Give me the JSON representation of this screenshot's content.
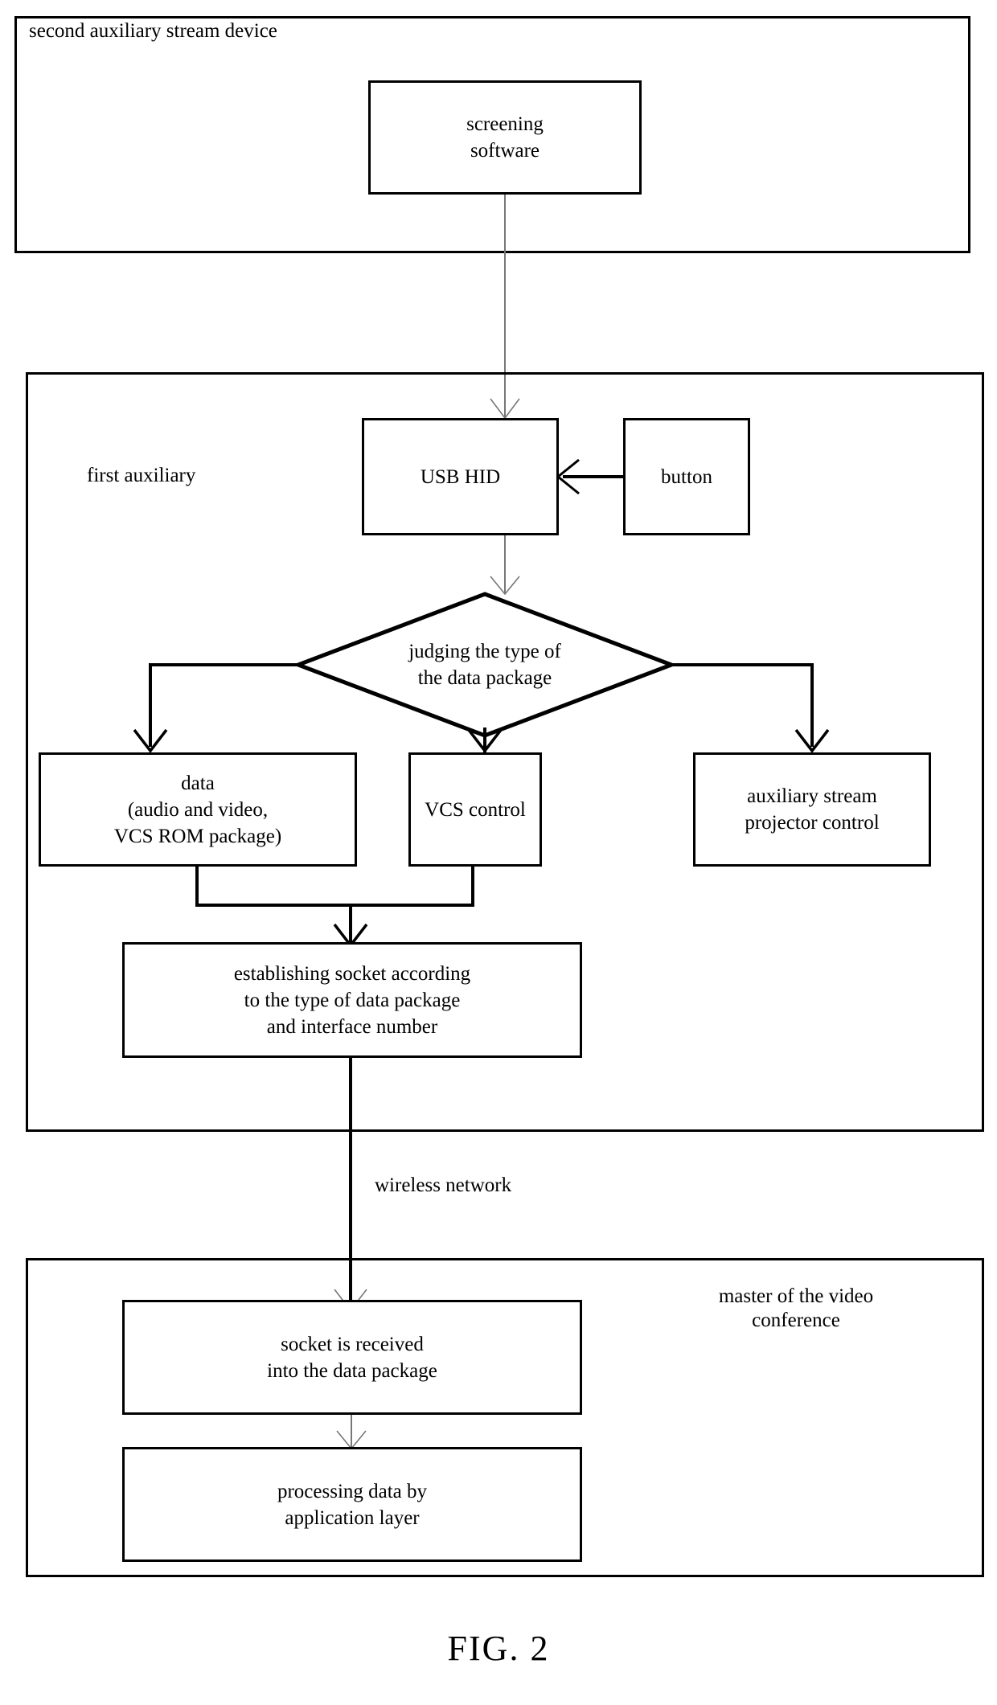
{
  "figure": {
    "caption": "FIG. 2"
  },
  "groups": {
    "second_auxiliary_stream_device": {
      "label": "second auxiliary stream device"
    },
    "first_auxiliary": {
      "label": "first auxiliary"
    },
    "master_of_video_conference": {
      "label": "master of the video\nconference"
    }
  },
  "nodes": {
    "screening_software": "screening\nsoftware",
    "usb_hid": "USB HID",
    "button": "button",
    "judging_type": "judging the type of\nthe data package",
    "data_package": "data\n(audio and video,\nVCS ROM package)",
    "vcs_control": "VCS control",
    "auxiliary_stream_projector_control": "auxiliary stream\nprojector control",
    "establishing_socket": "establishing socket according\nto the type of data package\nand interface number",
    "socket_received": "socket is received\ninto the data package",
    "processing_data": "processing data by\napplication layer"
  },
  "edges": {
    "wireless_network_label": "wireless network"
  },
  "colors": {
    "stroke": "#000000",
    "background": "#ffffff",
    "thin_stroke": "#555555"
  }
}
